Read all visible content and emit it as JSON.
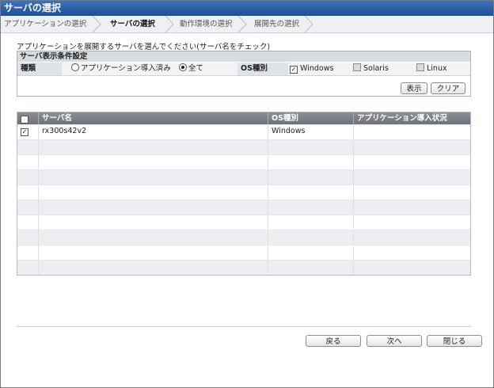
{
  "window": {
    "title": "サーバの選択"
  },
  "steps": [
    {
      "label": "アプリケーションの選択",
      "active": false
    },
    {
      "label": "サーバの選択",
      "active": true
    },
    {
      "label": "動作環境の選択",
      "active": false
    },
    {
      "label": "展開先の選択",
      "active": false
    }
  ],
  "instruction": "アプリケーションを展開するサーバを選んでください(サーバ名をチェック)",
  "filter": {
    "heading": "サーバ表示条件設定",
    "type_label": "種類",
    "type_options": [
      {
        "label": "アプリケーション導入済み",
        "selected": false
      },
      {
        "label": "全て",
        "selected": true
      }
    ],
    "os_label": "OS種別",
    "os_options": [
      {
        "label": "Windows",
        "checked": true
      },
      {
        "label": "Solaris",
        "checked": false
      },
      {
        "label": "Linux",
        "checked": false
      }
    ],
    "show_button": "表示",
    "clear_button": "クリア"
  },
  "table": {
    "headers": [
      "サーバ名",
      "OS種別",
      "アプリケーション導入状況"
    ],
    "rows": [
      {
        "checked": true,
        "cells": [
          "rx300s42v2",
          "Windows",
          ""
        ]
      }
    ],
    "empty_rows": 9
  },
  "footer": {
    "back": "戻る",
    "next": "次へ",
    "close": "閉じる"
  }
}
